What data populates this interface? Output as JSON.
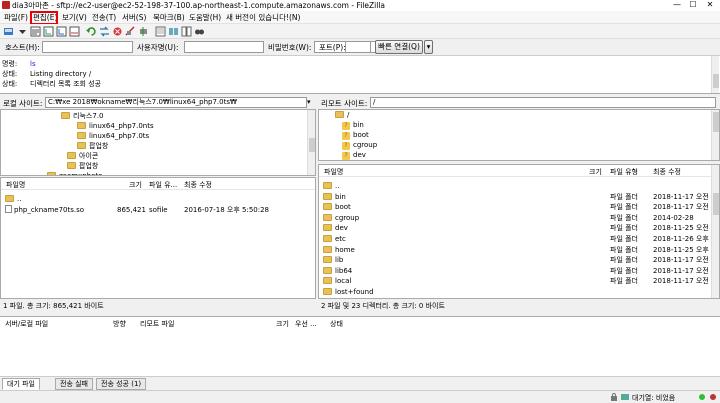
{
  "window": {
    "title": "dia3아마존 - sftp://ec2-user@ec2-52-198-37-100.ap-northeast-1.compute.amazonaws.com - FileZilla",
    "min_glyph": "—",
    "max_glyph": "☐",
    "close_glyph": "✕"
  },
  "menu": [
    "파일(F)",
    "편집(E)",
    "보기(V)",
    "전송(T)",
    "서버(S)",
    "북마크(B)",
    "도움말(H)",
    "새 버전이 있습니다!(N)"
  ],
  "quickconnect": {
    "host_label": "호스트(H):",
    "user_label": "사용자명(U):",
    "pass_label": "비밀번호(W):",
    "port_label": "포트(P):",
    "connect_label": "빠른 연결(Q)",
    "dropdown_glyph": "▾"
  },
  "log": [
    {
      "prefix": "명령:",
      "text": "ls",
      "color": "#1a1aff"
    },
    {
      "prefix": "상태:",
      "text": "Listing directory /",
      "color": "#000000"
    },
    {
      "prefix": "상태:",
      "text": "디렉터리 목록 조회 성공",
      "color": "#000000"
    }
  ],
  "local": {
    "site_label": "로컬 사이트:",
    "site_path": "C:₩xe 2018₩okname₩리눅스7.0₩linux64_php7.0ts₩",
    "tree": [
      {
        "label": "리눅스7.0",
        "indent": 0
      },
      {
        "label": "linux64_php7.0nts",
        "indent": 1
      },
      {
        "label": "linux64_php7.0ts",
        "indent": 1
      },
      {
        "label": "팝업창",
        "indent": 1
      },
      {
        "label": "아이콘",
        "indent": 0
      },
      {
        "label": "팝업창",
        "indent": 0
      },
      {
        "label": "zoomxphoto",
        "indent": -1
      }
    ],
    "headers": {
      "name": "파일명",
      "size": "크기",
      "type": "파일 유...",
      "modified": "최종 수정"
    },
    "files": [
      {
        "name": "..",
        "size": "",
        "type": "",
        "modified": "",
        "is_folder": true
      },
      {
        "name": "php_ckname70ts.so",
        "size": "865,421",
        "type": "sofile",
        "modified": "2016-07-18 오후 5:50:28",
        "is_folder": false
      }
    ],
    "status": "1 파일. 총 크기: 865,421 바이트"
  },
  "remote": {
    "site_label": "리모트 사이트:",
    "site_path": "/",
    "tree": [
      {
        "label": "/",
        "kind": "folder",
        "indent": 0
      },
      {
        "label": "bin",
        "kind": "q",
        "indent": 1
      },
      {
        "label": "boot",
        "kind": "q",
        "indent": 1
      },
      {
        "label": "cgroup",
        "kind": "q",
        "indent": 1
      },
      {
        "label": "dev",
        "kind": "q",
        "indent": 1
      }
    ],
    "headers": {
      "name": "파일명",
      "size": "크기",
      "type": "파일 유형",
      "modified": "최종 수정"
    },
    "files": [
      {
        "name": "..",
        "type": "",
        "modified": ""
      },
      {
        "name": "bin",
        "type": "파일 폴더",
        "modified": "2018-11-17 오전"
      },
      {
        "name": "boot",
        "type": "파일 폴더",
        "modified": "2018-11-17 오전"
      },
      {
        "name": "cgroup",
        "type": "파일 폴더",
        "modified": "2014-02-28"
      },
      {
        "name": "dev",
        "type": "파일 폴더",
        "modified": "2018-11-25 오전"
      },
      {
        "name": "etc",
        "type": "파일 폴더",
        "modified": "2018-11-26 오후"
      },
      {
        "name": "home",
        "type": "파일 폴더",
        "modified": "2018-11-25 오후"
      },
      {
        "name": "lib",
        "type": "파일 폴더",
        "modified": "2018-11-17 오전"
      },
      {
        "name": "lib64",
        "type": "파일 폴더",
        "modified": "2018-11-17 오전"
      },
      {
        "name": "local",
        "type": "파일 폴더",
        "modified": "2018-11-17 오전"
      },
      {
        "name": "lost+found",
        "type": "",
        "modified": ""
      }
    ],
    "status": "2 파일 및 23 디렉터리. 총 크기: 0 바이트"
  },
  "queue": {
    "headers": [
      "서버/로컬 파일",
      "방향",
      "리모트 파일",
      "크기",
      "우선 ...",
      "상태"
    ],
    "tabs": [
      "대기 파일",
      "전송 실패",
      "전송 성공 (1)"
    ]
  },
  "statusbar": {
    "queue_label": "대기열: 비었음"
  },
  "colors": {
    "selection_border": "#e00000",
    "folder": "#e8c158"
  }
}
